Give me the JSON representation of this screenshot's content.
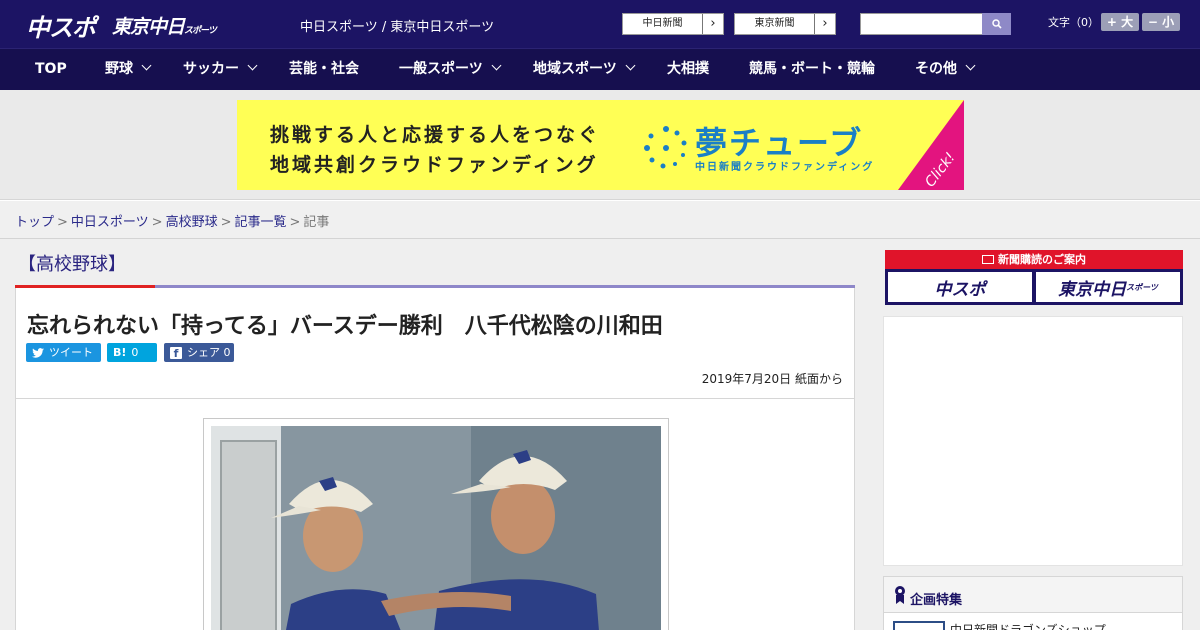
{
  "header": {
    "logo_main": "中スポ",
    "logo_tokyo": "東京中日",
    "logo_tokyo_small": "スポーツ",
    "site_title": "中日スポーツ / 東京中日スポーツ",
    "links": [
      {
        "label": "中日新聞",
        "arrow": "›"
      },
      {
        "label": "東京新聞",
        "arrow": "›"
      }
    ],
    "search": {
      "placeholder": ""
    },
    "font_size": {
      "label": "文字（0）",
      "bigger": "+ 大",
      "smaller": "− 小"
    }
  },
  "nav": {
    "items": [
      {
        "label": "TOP",
        "dropdown": false
      },
      {
        "label": "野球",
        "dropdown": true
      },
      {
        "label": "サッカー",
        "dropdown": true
      },
      {
        "label": "芸能・社会",
        "dropdown": false
      },
      {
        "label": "一般スポーツ",
        "dropdown": true
      },
      {
        "label": "地域スポーツ",
        "dropdown": true
      },
      {
        "label": "大相撲",
        "dropdown": false
      },
      {
        "label": "競馬・ボート・競輪",
        "dropdown": false
      },
      {
        "label": "その他",
        "dropdown": true
      }
    ]
  },
  "banner": {
    "line1": "挑戦する人と応援する人をつなぐ",
    "line2": "地域共創クラウドファンディング",
    "brand": "夢チューブ",
    "brand_sub": "中日新聞クラウドファンディング",
    "click": "Click!",
    "colors": {
      "background": "#ffff55",
      "brand": "#1a7fc6",
      "corner": "#e3147f"
    }
  },
  "breadcrumb": {
    "items": [
      "トップ",
      "中日スポーツ",
      "高校野球",
      "記事一覧"
    ],
    "current": "記事",
    "separator": ">"
  },
  "article": {
    "category": "【高校野球】",
    "headline": "忘れられない「持ってる」バースデー勝利　八千代松陰の川和田",
    "share": {
      "tweet": "ツイート",
      "hatena_icon": "B!",
      "hatena_count": "0",
      "facebook": "シェア",
      "facebook_count": "0"
    },
    "date": "2019年7月20日 紙面から"
  },
  "sidebar": {
    "subscription": {
      "title": "新聞購読のご案内",
      "buttons": [
        "中スポ",
        "東京中日"
      ],
      "tokyo_small": "スポーツ"
    },
    "feature": {
      "title": "企画特集",
      "item": "中日新聞ドラゴンズショップ"
    }
  },
  "colors": {
    "header": "#1c1464",
    "nav": "#160f4f",
    "accent_red": "#e02222",
    "twitter": "#1b95e0",
    "hatena": "#00a4de",
    "facebook": "#3b5998"
  }
}
